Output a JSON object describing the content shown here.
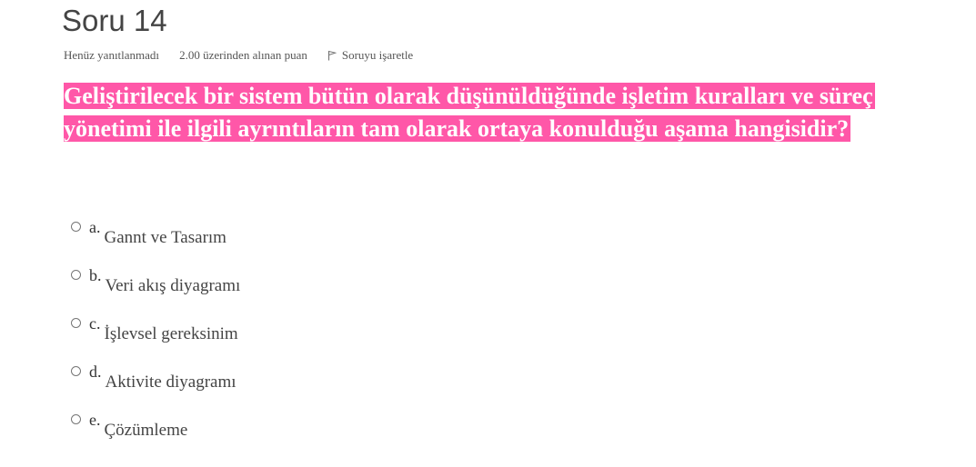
{
  "question": {
    "title": "Soru 14",
    "status": "Henüz yanıtlanmadı",
    "points": "2.00 üzerinden alınan puan",
    "flag_label": "Soruyu işaretle",
    "text": "Geliştirilecek bir sistem bütün olarak düşünüldüğünde işletim kuralları ve süreç yönetimi ile ilgili ayrıntıların tam olarak ortaya konulduğu aşama hangisidir?",
    "highlight_color": "#ff57a8"
  },
  "answers": [
    {
      "letter": "a.",
      "text": "Gannt ve Tasarım"
    },
    {
      "letter": "b.",
      "text": "Veri akış diyagramı"
    },
    {
      "letter": "c.",
      "text": "İşlevsel gereksinim"
    },
    {
      "letter": "d.",
      "text": "Aktivite diyagramı"
    },
    {
      "letter": "e.",
      "text": "Çözümleme"
    }
  ]
}
